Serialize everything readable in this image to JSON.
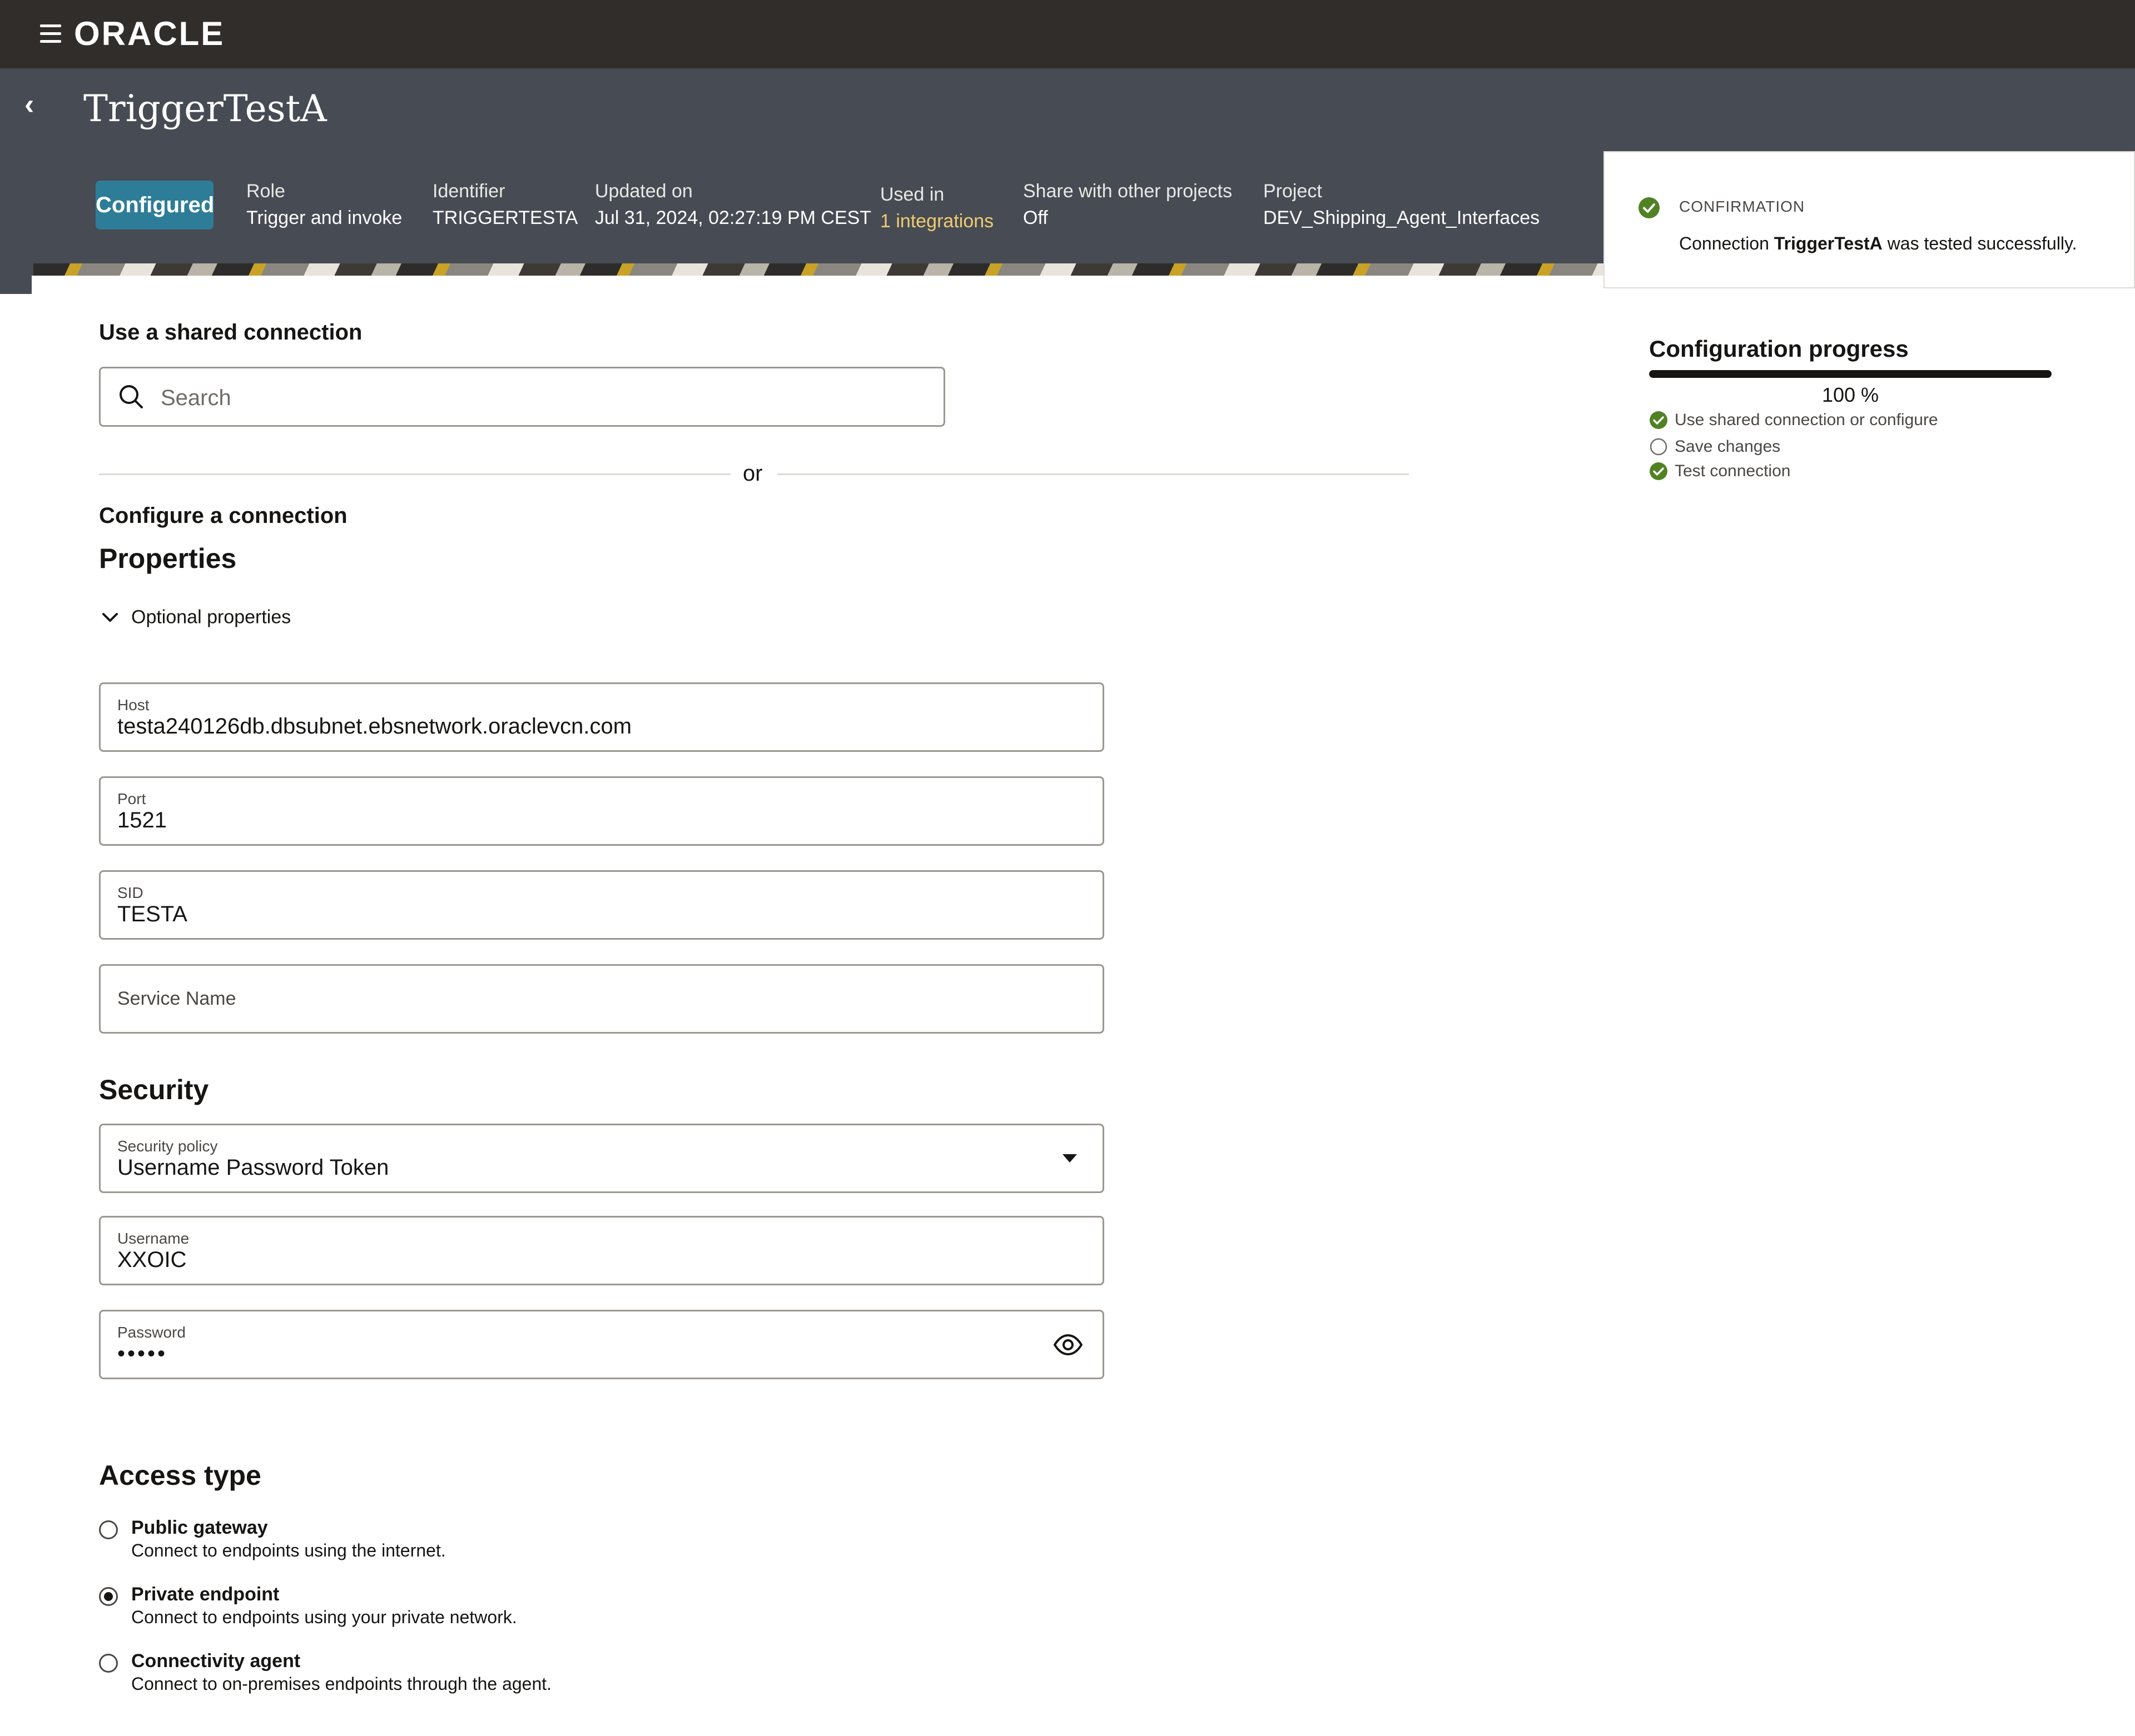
{
  "app": {
    "brand": "ORACLE"
  },
  "header": {
    "title": "TriggerTestA",
    "status_badge": "Configured",
    "meta": {
      "role_label": "Role",
      "role_value": "Trigger and invoke",
      "identifier_label": "Identifier",
      "identifier_value": "TRIGGERTESTA",
      "updated_label": "Updated on",
      "updated_value": "Jul 31, 2024, 02:27:19 PM CEST",
      "used_label": "Used in",
      "used_value": "1 integrations",
      "share_label": "Share with other projects",
      "share_value": "Off",
      "project_label": "Project",
      "project_value": "DEV_Shipping_Agent_Interfaces"
    }
  },
  "confirmation": {
    "title": "CONFIRMATION",
    "message_prefix": "Connection ",
    "message_name": "TriggerTestA",
    "message_suffix": " was tested successfully."
  },
  "progress": {
    "title": "Configuration progress",
    "percent": 100,
    "percent_label": "100 %",
    "steps": [
      {
        "label": "Use shared connection or configure",
        "done": true
      },
      {
        "label": "Save changes",
        "done": false
      },
      {
        "label": "Test connection",
        "done": true
      }
    ]
  },
  "shared": {
    "heading": "Use a shared connection",
    "search_placeholder": "Search",
    "or_label": "or"
  },
  "configure": {
    "heading": "Configure a connection",
    "properties_heading": "Properties",
    "optional_toggle": "Optional properties",
    "fields": {
      "host_label": "Host",
      "host_value": "testa240126db.dbsubnet.ebsnetwork.oraclevcn.com",
      "port_label": "Port",
      "port_value": "1521",
      "sid_label": "SID",
      "sid_value": "TESTA",
      "service_placeholder": "Service Name"
    }
  },
  "security": {
    "heading": "Security",
    "policy_label": "Security policy",
    "policy_value": "Username Password Token",
    "username_label": "Username",
    "username_value": "XXOIC",
    "password_label": "Password",
    "password_value": "•••••"
  },
  "access": {
    "heading": "Access type",
    "options": [
      {
        "label": "Public gateway",
        "desc": "Connect to endpoints using the internet.",
        "selected": false
      },
      {
        "label": "Private endpoint",
        "desc": "Connect to endpoints using your private network.",
        "selected": true
      },
      {
        "label": "Connectivity agent",
        "desc": "Connect to on-premises endpoints through the agent.",
        "selected": false
      }
    ]
  },
  "colors": {
    "header_bg": "#474b53",
    "brand_bg": "#312d2a",
    "badge": "#2e7d98",
    "success": "#508223",
    "link": "#f0cc71"
  }
}
